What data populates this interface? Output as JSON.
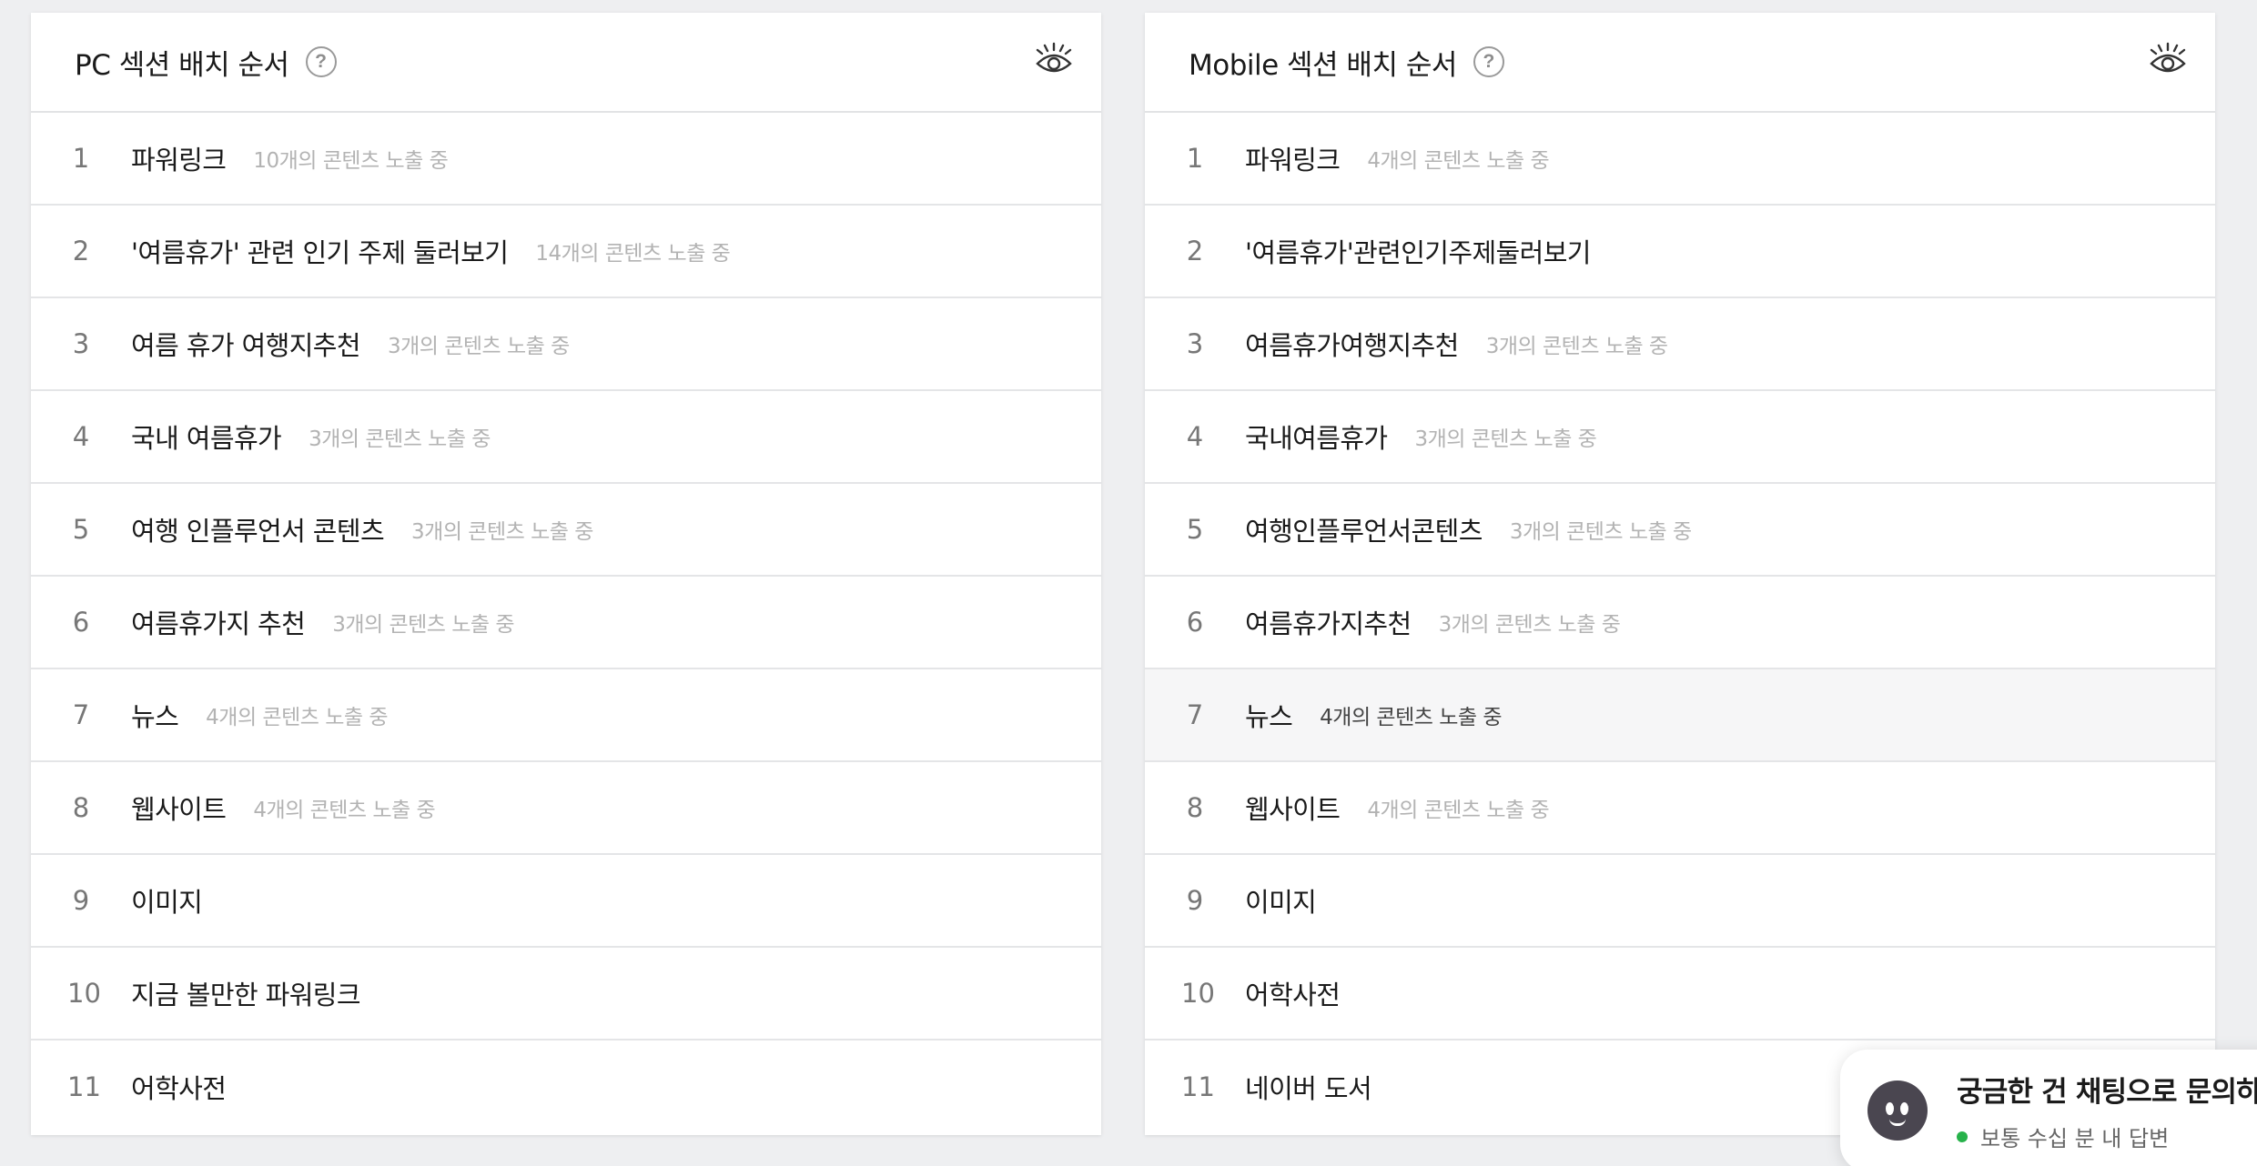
{
  "pc": {
    "title": "PC 섹션 배치 순서",
    "help": "?",
    "rows": [
      {
        "num": "1",
        "name": "파워링크",
        "count": "10개의 콘텐츠 노출 중"
      },
      {
        "num": "2",
        "name": "'여름휴가' 관련 인기 주제 둘러보기",
        "count": "14개의 콘텐츠 노출 중"
      },
      {
        "num": "3",
        "name": "여름 휴가 여행지추천",
        "count": "3개의 콘텐츠 노출 중"
      },
      {
        "num": "4",
        "name": "국내 여름휴가",
        "count": "3개의 콘텐츠 노출 중"
      },
      {
        "num": "5",
        "name": "여행 인플루언서 콘텐츠",
        "count": "3개의 콘텐츠 노출 중"
      },
      {
        "num": "6",
        "name": "여름휴가지 추천",
        "count": "3개의 콘텐츠 노출 중"
      },
      {
        "num": "7",
        "name": "뉴스",
        "count": "4개의 콘텐츠 노출 중"
      },
      {
        "num": "8",
        "name": "웹사이트",
        "count": "4개의 콘텐츠 노출 중"
      },
      {
        "num": "9",
        "name": "이미지",
        "count": ""
      },
      {
        "num": "10",
        "name": "지금 볼만한 파워링크",
        "count": ""
      },
      {
        "num": "11",
        "name": "어학사전",
        "count": ""
      }
    ]
  },
  "mobile": {
    "title": "Mobile 섹션 배치 순서",
    "help": "?",
    "rows": [
      {
        "num": "1",
        "name": "파워링크",
        "count": "4개의 콘텐츠 노출 중"
      },
      {
        "num": "2",
        "name": "'여름휴가'관련인기주제둘러보기",
        "count": ""
      },
      {
        "num": "3",
        "name": "여름휴가여행지추천",
        "count": "3개의 콘텐츠 노출 중"
      },
      {
        "num": "4",
        "name": "국내여름휴가",
        "count": "3개의 콘텐츠 노출 중"
      },
      {
        "num": "5",
        "name": "여행인플루언서콘텐츠",
        "count": "3개의 콘텐츠 노출 중"
      },
      {
        "num": "6",
        "name": "여름휴가지추천",
        "count": "3개의 콘텐츠 노출 중"
      },
      {
        "num": "7",
        "name": "뉴스",
        "count": "4개의 콘텐츠 노출 중"
      },
      {
        "num": "8",
        "name": "웹사이트",
        "count": "4개의 콘텐츠 노출 중"
      },
      {
        "num": "9",
        "name": "이미지",
        "count": ""
      },
      {
        "num": "10",
        "name": "어학사전",
        "count": ""
      },
      {
        "num": "11",
        "name": "네이버 도서",
        "count": ""
      }
    ]
  },
  "chat": {
    "title": "궁금한 건 채팅으로 문의하",
    "status": "보통 수십 분 내 답변",
    "status_color": "#27b24a"
  },
  "icons": {
    "help": "question-circle-icon",
    "preview": "eye-icon"
  }
}
